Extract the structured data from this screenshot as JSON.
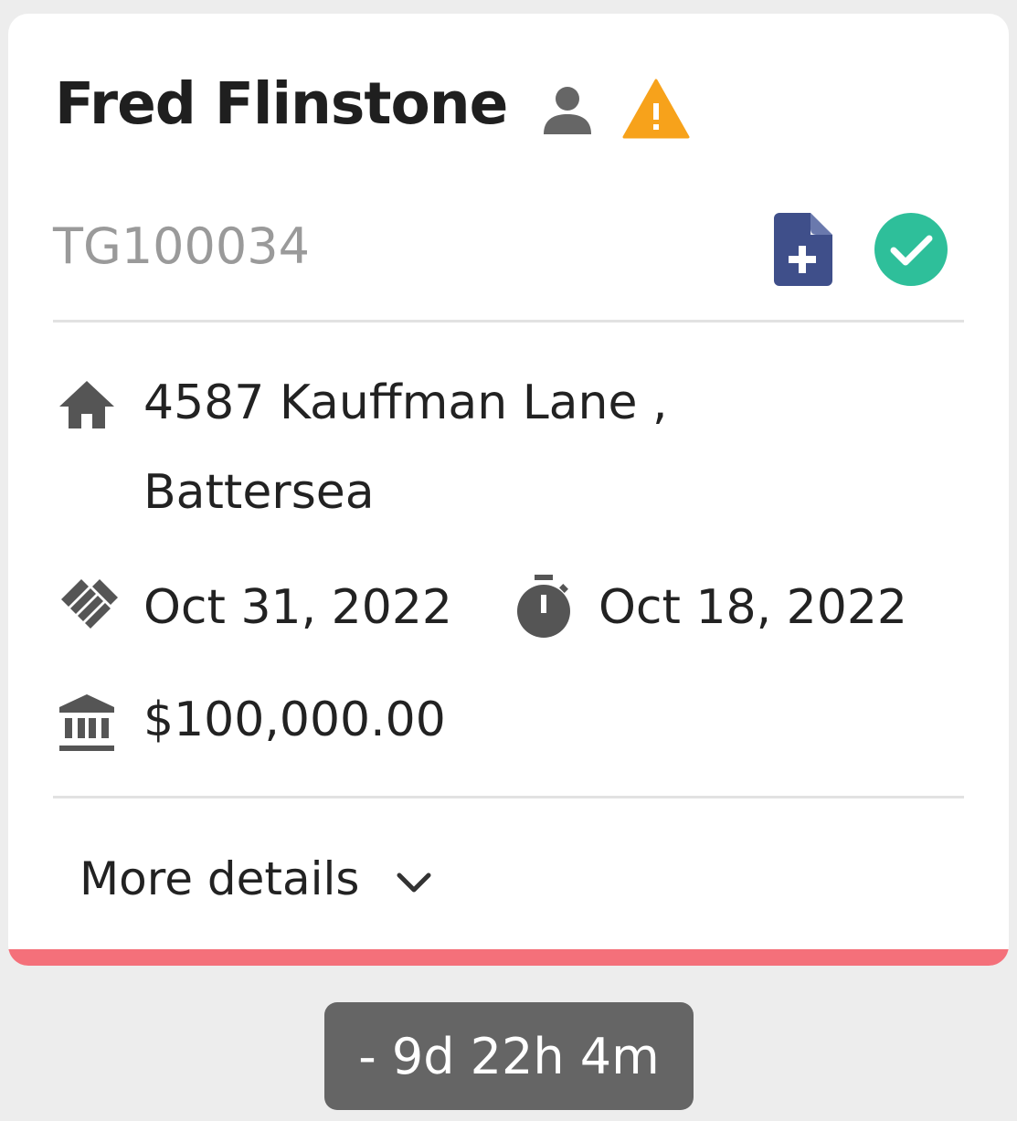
{
  "card": {
    "name": "Fred Flinstone",
    "reference": "TG100034",
    "address_line1": "4587 Kauffman Lane ,",
    "address_line2": "Battersea",
    "agreed_date": "Oct 31, 2022",
    "deadline_date": "Oct 18, 2022",
    "amount": "$100,000.00",
    "more_details_label": "More details",
    "accent_color": "#f4707a",
    "icons": {
      "person": "person-icon",
      "warning": "warning-icon",
      "document": "document-add-icon",
      "status": "check-circle-icon",
      "address": "home-icon",
      "agreed": "handshake-icon",
      "deadline": "stopwatch-icon",
      "amount": "bank-icon",
      "expand": "chevron-down-icon"
    },
    "colors": {
      "warning": "#f7a21b",
      "document": "#3f4f8a",
      "status": "#2ebf9a"
    }
  },
  "timer": {
    "label": "- 9d 22h 4m"
  }
}
